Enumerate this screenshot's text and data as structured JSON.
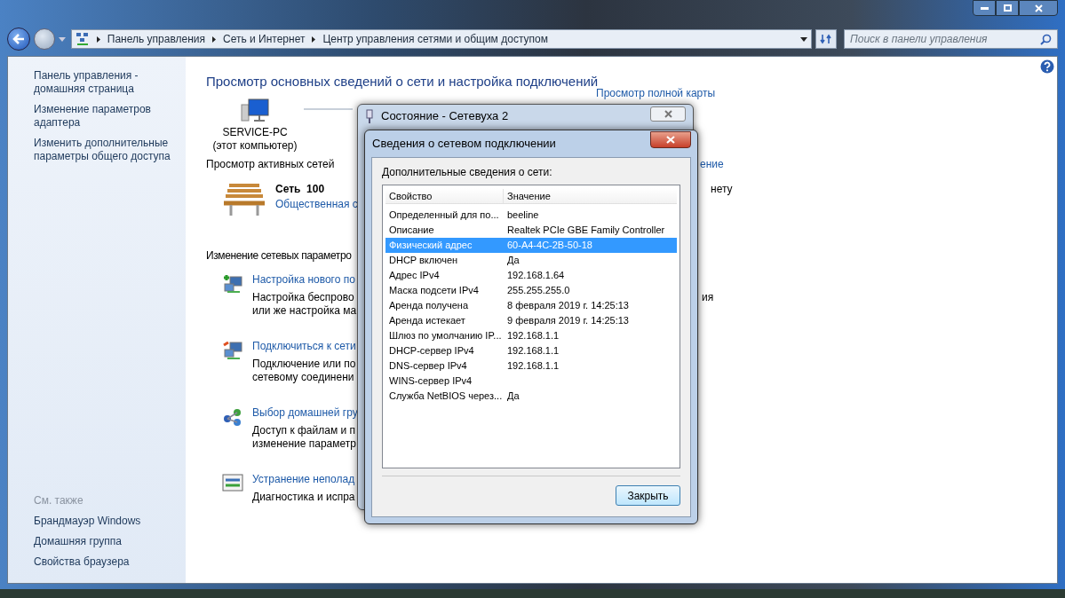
{
  "address_bar": {
    "breadcrumbs": [
      "Панель управления",
      "Сеть и Интернет",
      "Центр управления сетями и общим доступом"
    ],
    "search": {
      "placeholder": "Поиск в панели управления"
    }
  },
  "sidebar": {
    "links": [
      "Панель управления - домашняя страница",
      "Изменение параметров адаптера",
      "Изменить дополнительные параметры общего доступа"
    ],
    "see_also": {
      "title": "См. также",
      "links": [
        "Брандмауэр Windows",
        "Домашняя группа",
        "Свойства браузера"
      ]
    }
  },
  "main": {
    "heading": "Просмотр основных сведений о сети и настройка подключений",
    "network_map": {
      "computer_name": "SERVICE-PC",
      "computer_note": "(этот компьютер)",
      "full_map_link": "Просмотр полной карты"
    },
    "active_networks": {
      "title": "Просмотр активных сетей",
      "network_name": "Сеть  100",
      "network_type": "Общественная с",
      "link_fragment": "ение",
      "text_fragment": "нету"
    },
    "change_settings": {
      "title": "Изменение сетевых параметро",
      "text_fragment": "ия",
      "items": [
        {
          "kind": "new-connection",
          "link": "Настройка нового по",
          "lines": [
            "Настройка беспрово",
            "или же настройка ма"
          ]
        },
        {
          "kind": "connect",
          "link": "Подключиться к сети",
          "lines": [
            "Подключение или по",
            "сетевому соединени"
          ]
        },
        {
          "kind": "homegroup",
          "link": "Выбор домашней гру",
          "lines": [
            "Доступ к файлам и п",
            "изменение параметр"
          ]
        },
        {
          "kind": "troubleshoot",
          "link": "Устранение неполад",
          "lines": [
            "Диагностика и испра"
          ]
        }
      ]
    }
  },
  "status_window": {
    "title": "Состояние - Сетевуха 2"
  },
  "details_dialog": {
    "title": "Сведения о сетевом подключении",
    "caption": "Дополнительные сведения о сети:",
    "columns": [
      "Свойство",
      "Значение"
    ],
    "rows": [
      {
        "property": "Определенный для по...",
        "value": "beeline",
        "selected": false
      },
      {
        "property": "Описание",
        "value": "Realtek PCIe GBE Family Controller",
        "selected": false
      },
      {
        "property": "Физический адрес",
        "value": "60-A4-4C-2B-50-18",
        "selected": true
      },
      {
        "property": "DHCP включен",
        "value": "Да",
        "selected": false
      },
      {
        "property": "Адрес IPv4",
        "value": "192.168.1.64",
        "selected": false
      },
      {
        "property": "Маска подсети IPv4",
        "value": "255.255.255.0",
        "selected": false
      },
      {
        "property": "Аренда получена",
        "value": "8 февраля 2019 г. 14:25:13",
        "selected": false
      },
      {
        "property": "Аренда истекает",
        "value": "9 февраля 2019 г. 14:25:13",
        "selected": false
      },
      {
        "property": "Шлюз по умолчанию IP...",
        "value": "192.168.1.1",
        "selected": false
      },
      {
        "property": "DHCP-сервер IPv4",
        "value": "192.168.1.1",
        "selected": false
      },
      {
        "property": "DNS-сервер IPv4",
        "value": "192.168.1.1",
        "selected": false
      },
      {
        "property": "WINS-сервер IPv4",
        "selected": false
      },
      {
        "property": "Служба NetBIOS через...",
        "value": "Да",
        "selected": false
      }
    ],
    "close_button": "Закрыть"
  }
}
